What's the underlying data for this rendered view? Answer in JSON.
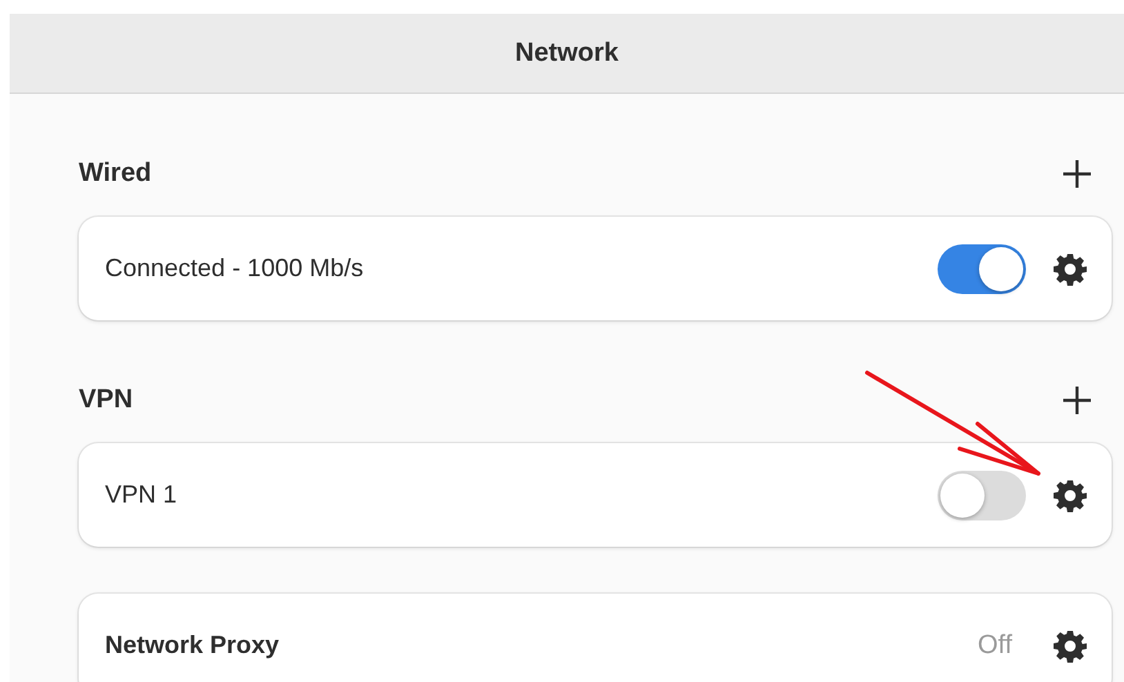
{
  "window": {
    "title": "Network"
  },
  "sections": [
    {
      "title": "Wired",
      "rows": [
        {
          "kind": "toggle",
          "label": "Connected - 1000 Mb/s",
          "on": true
        }
      ]
    },
    {
      "title": "VPN",
      "rows": [
        {
          "kind": "toggle",
          "label": "VPN 1",
          "on": false
        }
      ]
    },
    {
      "rows": [
        {
          "kind": "status",
          "label": "Network Proxy",
          "value": "Off"
        }
      ]
    }
  ]
}
